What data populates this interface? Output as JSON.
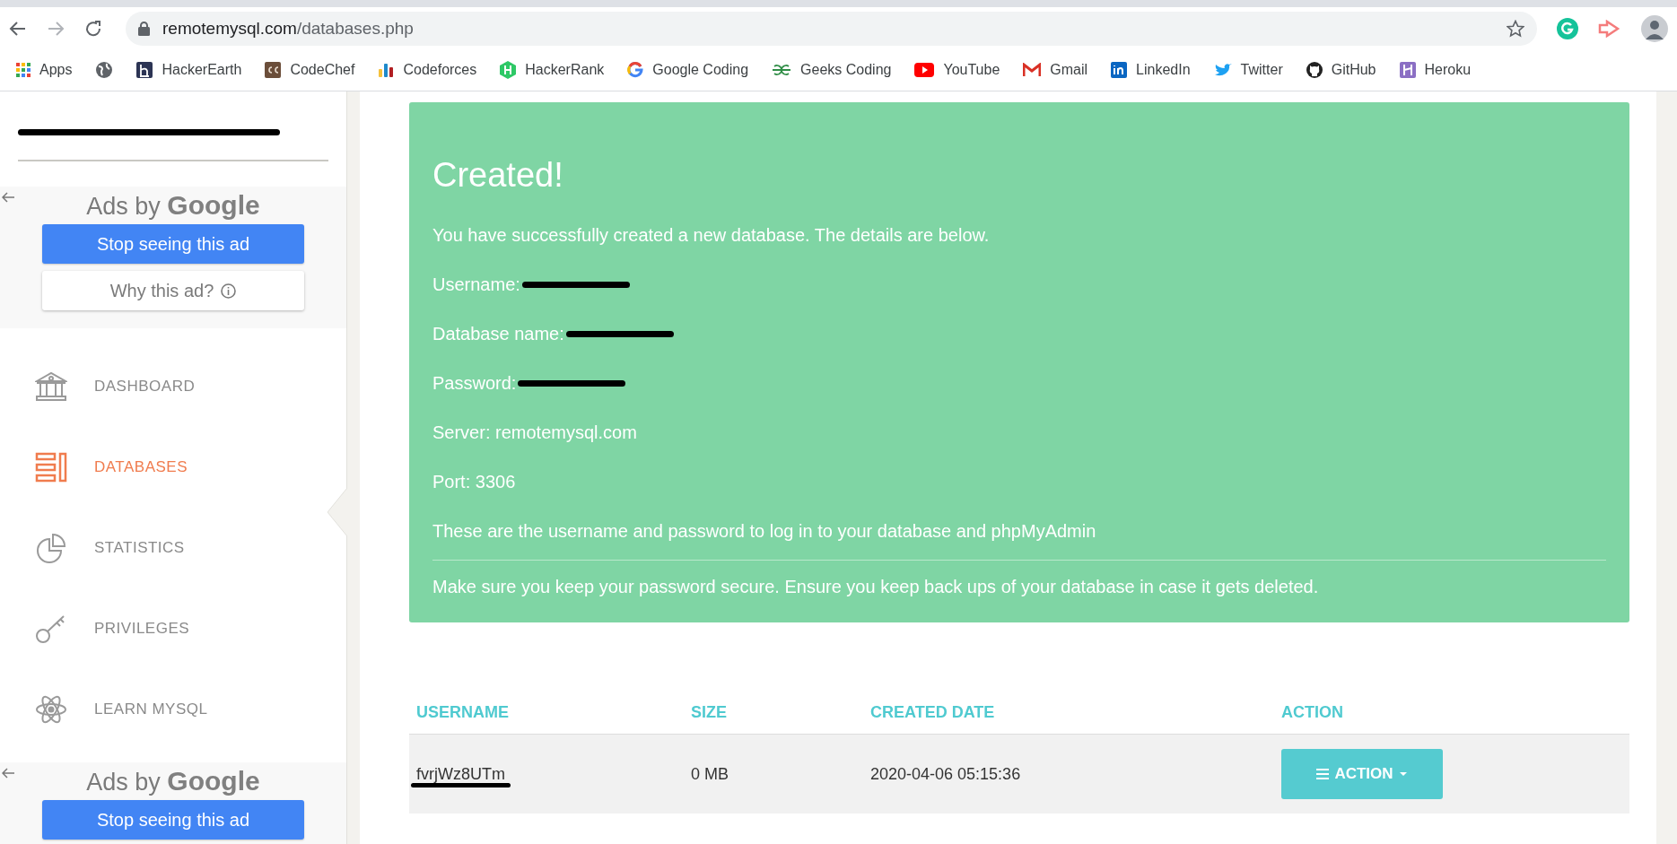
{
  "browser": {
    "url_host": "remotemysql.com",
    "url_path": "/databases.php",
    "bookmarks": [
      {
        "label": "Apps"
      },
      {
        "label": "HackerEarth"
      },
      {
        "label": "CodeChef"
      },
      {
        "label": "Codeforces"
      },
      {
        "label": "HackerRank"
      },
      {
        "label": "Google Coding"
      },
      {
        "label": "Geeks Coding"
      },
      {
        "label": "YouTube"
      },
      {
        "label": "Gmail"
      },
      {
        "label": "LinkedIn"
      },
      {
        "label": "Twitter"
      },
      {
        "label": "GitHub"
      },
      {
        "label": "Heroku"
      }
    ]
  },
  "sidebar": {
    "ads": [
      {
        "heading": "Ads by",
        "brand": "Google",
        "stop": "Stop seeing this ad",
        "why": "Why this ad?"
      },
      {
        "heading": "Ads by",
        "brand": "Google",
        "stop": "Stop seeing this ad"
      }
    ],
    "items": [
      {
        "label": "DASHBOARD",
        "selected": false
      },
      {
        "label": "DATABASES",
        "selected": true
      },
      {
        "label": "STATISTICS",
        "selected": false
      },
      {
        "label": "PRIVILEGES",
        "selected": false
      },
      {
        "label": "LEARN MYSQL",
        "selected": false
      }
    ]
  },
  "alert": {
    "title": "Created!",
    "intro": "You have successfully created a new database. The details are below.",
    "fields": [
      {
        "label": "Username:",
        "redacted": true
      },
      {
        "label": "Database name:",
        "redacted": true
      },
      {
        "label": "Password:",
        "redacted": true
      },
      {
        "label": "Server: remotemysql.com",
        "redacted": false
      },
      {
        "label": "Port: 3306",
        "redacted": false
      }
    ],
    "info": "These are the username and password to log in to your database and phpMyAdmin",
    "note": "Make sure you keep your password secure. Ensure you keep back ups of your database in case it gets deleted."
  },
  "table": {
    "columns": [
      "USERNAME",
      "SIZE",
      "CREATED DATE",
      "ACTION"
    ],
    "rows": [
      {
        "username": "fvrjWz8UTm",
        "redacted": true,
        "size": "0 MB",
        "created": "2020-04-06 05:15:36",
        "action": "ACTION"
      }
    ]
  }
}
